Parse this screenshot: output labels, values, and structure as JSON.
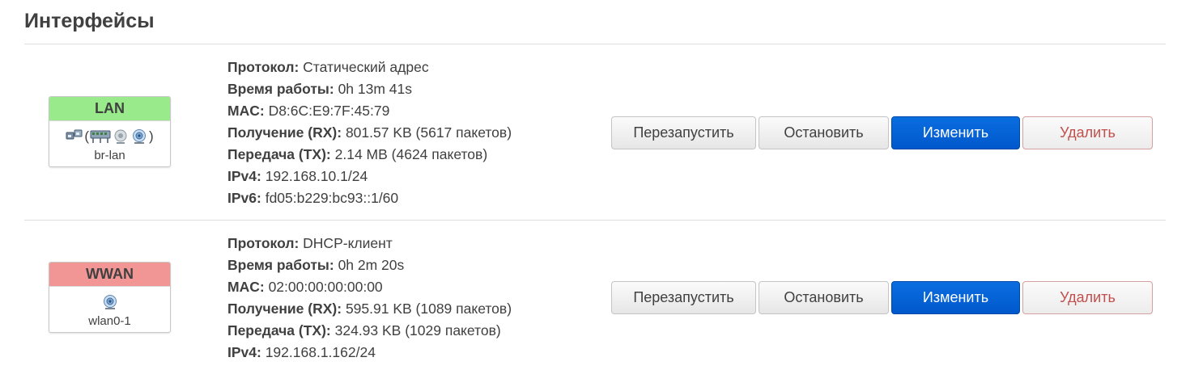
{
  "page": {
    "title": "Интерфейсы"
  },
  "labels": {
    "protocol": "Протокол:",
    "uptime": "Время работы:",
    "mac": "MAC:",
    "rx": "Получение (RX):",
    "tx": "Передача (TX):",
    "ipv4": "IPv4:",
    "ipv6": "IPv6:"
  },
  "buttons": {
    "restart": "Перезапустить",
    "stop": "Остановить",
    "edit": "Изменить",
    "delete": "Удалить"
  },
  "colors": {
    "lan_header": "#98ea8a",
    "wwan_header": "#f19595",
    "primary": "#0a64d8",
    "danger_text": "#c0504d"
  },
  "interfaces": [
    {
      "name": "LAN",
      "device": "br-lan",
      "icons": [
        "ethernet-switch-icon",
        "bridge-icon",
        "ethernet-port-icon",
        "wifi-icon"
      ],
      "protocol": "Статический адрес",
      "uptime": "0h 13m 41s",
      "mac": "D8:6C:E9:7F:45:79",
      "rx": "801.57 KB (5617 пакетов)",
      "tx": "2.14 MB (4624 пакетов)",
      "ipv4": "192.168.10.1/24",
      "ipv6": "fd05:b229:bc93::1/60"
    },
    {
      "name": "WWAN",
      "device": "wlan0-1",
      "icons": [
        "wifi-icon"
      ],
      "protocol": "DHCP-клиент",
      "uptime": "0h 2m 20s",
      "mac": "02:00:00:00:00:00",
      "rx": "595.91 KB (1089 пакетов)",
      "tx": "324.93 KB (1029 пакетов)",
      "ipv4": "192.168.1.162/24"
    }
  ]
}
